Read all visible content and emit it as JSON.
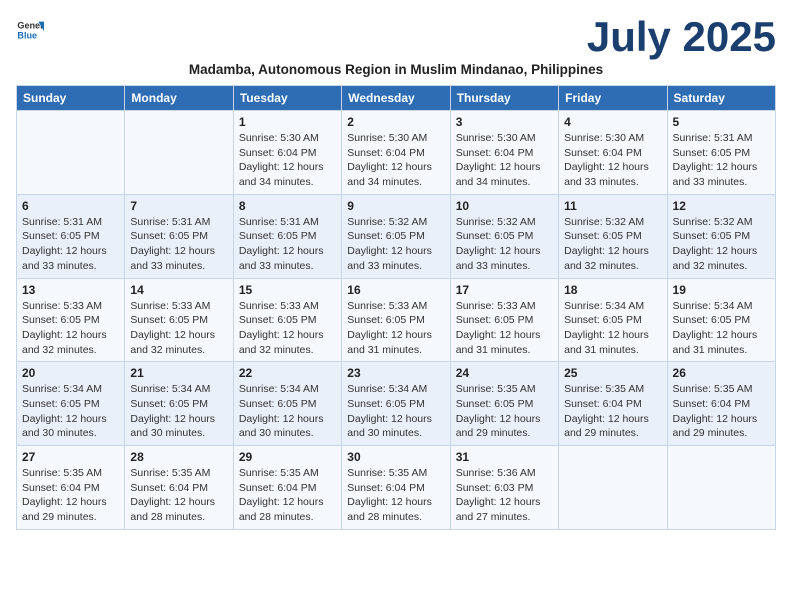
{
  "logo": {
    "text_general": "General",
    "text_blue": "Blue"
  },
  "title": "July 2025",
  "subtitle": "Madamba, Autonomous Region in Muslim Mindanao, Philippines",
  "weekdays": [
    "Sunday",
    "Monday",
    "Tuesday",
    "Wednesday",
    "Thursday",
    "Friday",
    "Saturday"
  ],
  "weeks": [
    [
      {
        "day": "",
        "detail": ""
      },
      {
        "day": "",
        "detail": ""
      },
      {
        "day": "1",
        "detail": "Sunrise: 5:30 AM\nSunset: 6:04 PM\nDaylight: 12 hours and 34 minutes."
      },
      {
        "day": "2",
        "detail": "Sunrise: 5:30 AM\nSunset: 6:04 PM\nDaylight: 12 hours and 34 minutes."
      },
      {
        "day": "3",
        "detail": "Sunrise: 5:30 AM\nSunset: 6:04 PM\nDaylight: 12 hours and 34 minutes."
      },
      {
        "day": "4",
        "detail": "Sunrise: 5:30 AM\nSunset: 6:04 PM\nDaylight: 12 hours and 33 minutes."
      },
      {
        "day": "5",
        "detail": "Sunrise: 5:31 AM\nSunset: 6:05 PM\nDaylight: 12 hours and 33 minutes."
      }
    ],
    [
      {
        "day": "6",
        "detail": "Sunrise: 5:31 AM\nSunset: 6:05 PM\nDaylight: 12 hours and 33 minutes."
      },
      {
        "day": "7",
        "detail": "Sunrise: 5:31 AM\nSunset: 6:05 PM\nDaylight: 12 hours and 33 minutes."
      },
      {
        "day": "8",
        "detail": "Sunrise: 5:31 AM\nSunset: 6:05 PM\nDaylight: 12 hours and 33 minutes."
      },
      {
        "day": "9",
        "detail": "Sunrise: 5:32 AM\nSunset: 6:05 PM\nDaylight: 12 hours and 33 minutes."
      },
      {
        "day": "10",
        "detail": "Sunrise: 5:32 AM\nSunset: 6:05 PM\nDaylight: 12 hours and 33 minutes."
      },
      {
        "day": "11",
        "detail": "Sunrise: 5:32 AM\nSunset: 6:05 PM\nDaylight: 12 hours and 32 minutes."
      },
      {
        "day": "12",
        "detail": "Sunrise: 5:32 AM\nSunset: 6:05 PM\nDaylight: 12 hours and 32 minutes."
      }
    ],
    [
      {
        "day": "13",
        "detail": "Sunrise: 5:33 AM\nSunset: 6:05 PM\nDaylight: 12 hours and 32 minutes."
      },
      {
        "day": "14",
        "detail": "Sunrise: 5:33 AM\nSunset: 6:05 PM\nDaylight: 12 hours and 32 minutes."
      },
      {
        "day": "15",
        "detail": "Sunrise: 5:33 AM\nSunset: 6:05 PM\nDaylight: 12 hours and 32 minutes."
      },
      {
        "day": "16",
        "detail": "Sunrise: 5:33 AM\nSunset: 6:05 PM\nDaylight: 12 hours and 31 minutes."
      },
      {
        "day": "17",
        "detail": "Sunrise: 5:33 AM\nSunset: 6:05 PM\nDaylight: 12 hours and 31 minutes."
      },
      {
        "day": "18",
        "detail": "Sunrise: 5:34 AM\nSunset: 6:05 PM\nDaylight: 12 hours and 31 minutes."
      },
      {
        "day": "19",
        "detail": "Sunrise: 5:34 AM\nSunset: 6:05 PM\nDaylight: 12 hours and 31 minutes."
      }
    ],
    [
      {
        "day": "20",
        "detail": "Sunrise: 5:34 AM\nSunset: 6:05 PM\nDaylight: 12 hours and 30 minutes."
      },
      {
        "day": "21",
        "detail": "Sunrise: 5:34 AM\nSunset: 6:05 PM\nDaylight: 12 hours and 30 minutes."
      },
      {
        "day": "22",
        "detail": "Sunrise: 5:34 AM\nSunset: 6:05 PM\nDaylight: 12 hours and 30 minutes."
      },
      {
        "day": "23",
        "detail": "Sunrise: 5:34 AM\nSunset: 6:05 PM\nDaylight: 12 hours and 30 minutes."
      },
      {
        "day": "24",
        "detail": "Sunrise: 5:35 AM\nSunset: 6:05 PM\nDaylight: 12 hours and 29 minutes."
      },
      {
        "day": "25",
        "detail": "Sunrise: 5:35 AM\nSunset: 6:04 PM\nDaylight: 12 hours and 29 minutes."
      },
      {
        "day": "26",
        "detail": "Sunrise: 5:35 AM\nSunset: 6:04 PM\nDaylight: 12 hours and 29 minutes."
      }
    ],
    [
      {
        "day": "27",
        "detail": "Sunrise: 5:35 AM\nSunset: 6:04 PM\nDaylight: 12 hours and 29 minutes."
      },
      {
        "day": "28",
        "detail": "Sunrise: 5:35 AM\nSunset: 6:04 PM\nDaylight: 12 hours and 28 minutes."
      },
      {
        "day": "29",
        "detail": "Sunrise: 5:35 AM\nSunset: 6:04 PM\nDaylight: 12 hours and 28 minutes."
      },
      {
        "day": "30",
        "detail": "Sunrise: 5:35 AM\nSunset: 6:04 PM\nDaylight: 12 hours and 28 minutes."
      },
      {
        "day": "31",
        "detail": "Sunrise: 5:36 AM\nSunset: 6:03 PM\nDaylight: 12 hours and 27 minutes."
      },
      {
        "day": "",
        "detail": ""
      },
      {
        "day": "",
        "detail": ""
      }
    ]
  ]
}
